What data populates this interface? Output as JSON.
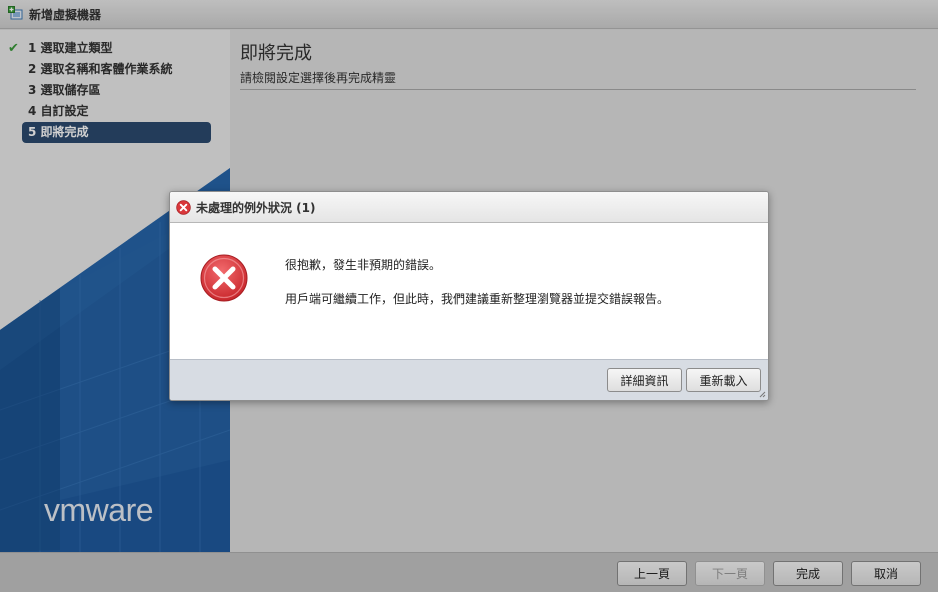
{
  "window": {
    "title": "新增虛擬機器"
  },
  "wizard": {
    "steps": [
      {
        "label": "1 選取建立類型",
        "done": true
      },
      {
        "label": "2 選取名稱和客體作業系統",
        "done": false
      },
      {
        "label": "3 選取儲存區",
        "done": false
      },
      {
        "label": "4 自訂設定",
        "done": false
      },
      {
        "label": "5 即將完成",
        "active": true
      }
    ],
    "brand": "vmware"
  },
  "content": {
    "title": "即將完成",
    "subtitle": "請檢閱設定選擇後再完成精靈"
  },
  "footer": {
    "back": "上一頁",
    "next": "下一頁",
    "finish": "完成",
    "cancel": "取消"
  },
  "dialog": {
    "title": "未處理的例外狀況 (1)",
    "message1": "很抱歉，發生非預期的錯誤。",
    "message2": "用戶端可繼續工作，但此時，我們建議重新整理瀏覽器並提交錯誤報告。",
    "details_button": "詳細資訊",
    "reload_button": "重新載入"
  },
  "colors": {
    "active_step": "#2b4a6e",
    "brand_blue": "#1f5a9e",
    "error_red": "#d9373b",
    "check_green": "#3a9a3a"
  }
}
